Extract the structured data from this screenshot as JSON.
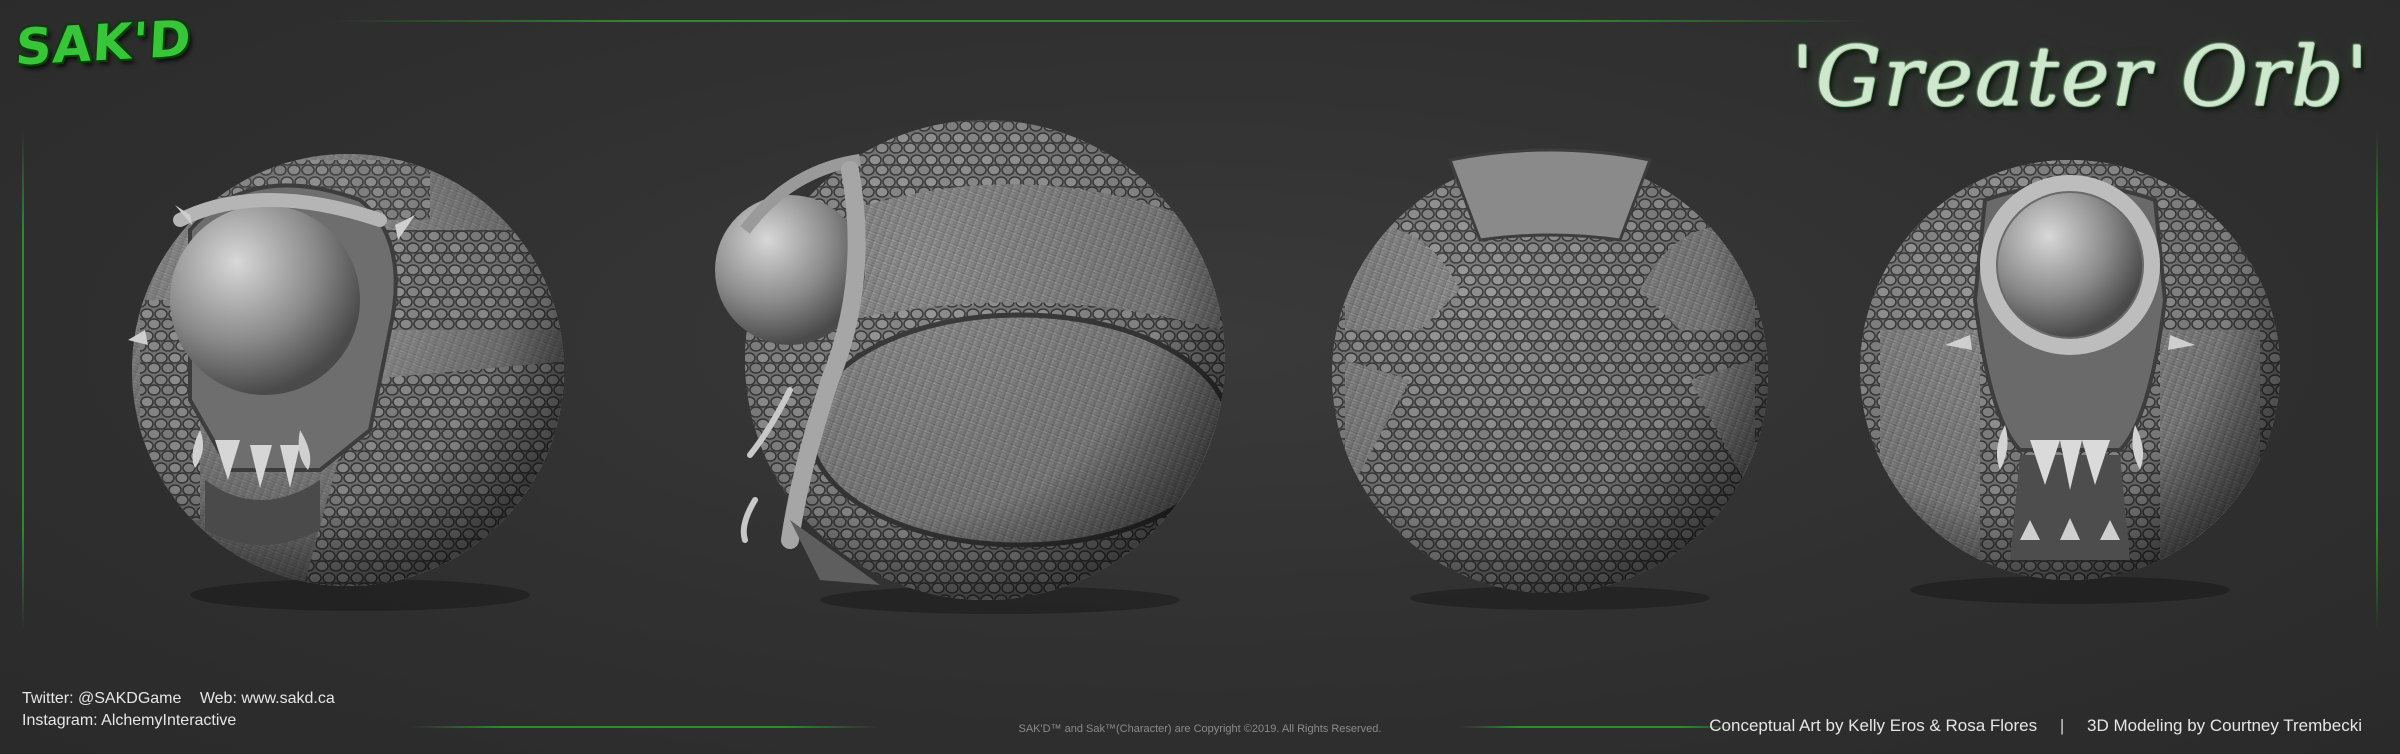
{
  "logo": {
    "text": "SAK'D"
  },
  "title": "'Greater Orb'",
  "views": [
    "front-three-quarter",
    "side",
    "back",
    "front"
  ],
  "social": {
    "twitter": "Twitter: @SAKDGame",
    "web": "Web: www.sakd.ca",
    "instagram": "Instagram: AlchemyInteractive"
  },
  "copyright": "SAK'D™ and Sak™(Character) are Copyright ©2019. All Rights Reserved.",
  "credits": {
    "concept": "Conceptual Art by Kelly Eros  & Rosa Flores",
    "separator": "|",
    "modeling": "3D Modeling by Courtney Trembecki"
  },
  "colors": {
    "background": "#2f2f2f",
    "accent_green": "#2e8a2e",
    "logo_green": "#39c53a"
  }
}
